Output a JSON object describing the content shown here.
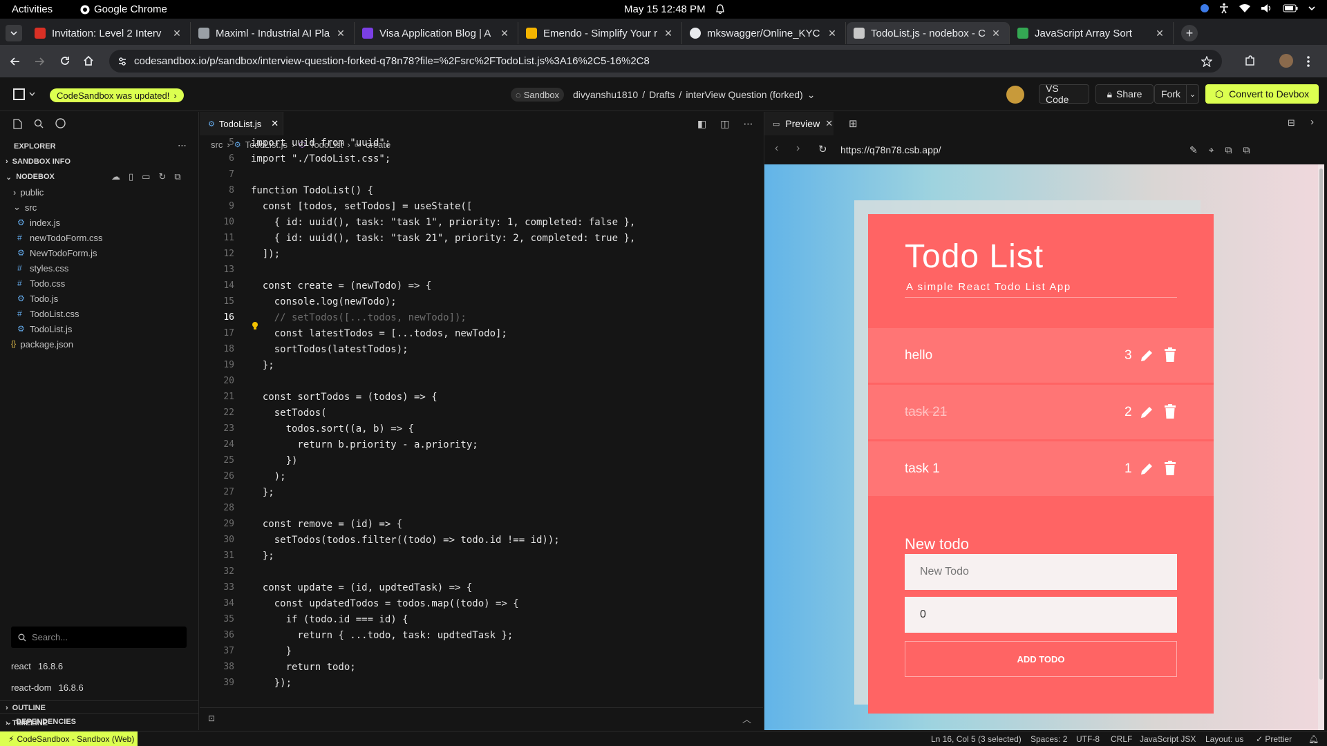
{
  "system": {
    "activities": "Activities",
    "app_name": "Google Chrome",
    "clock": "May 15  12:48 PM"
  },
  "browser": {
    "tabs": [
      {
        "title": "Invitation: Level 2 Interv",
        "color": "#d93025"
      },
      {
        "title": "Maximl - Industrial AI Pla",
        "color": "#9aa0a6"
      },
      {
        "title": "Visa Application Blog | A",
        "color": "#7b3fe4"
      },
      {
        "title": "Emendo - Simplify Your r",
        "color": "#f4b400"
      },
      {
        "title": "mkswagger/Online_KYC",
        "color": "#e8eaed"
      },
      {
        "title": "TodoList.js - nodebox - C",
        "color": "#c8c8c8"
      },
      {
        "title": "JavaScript Array Sort",
        "color": "#34a853"
      }
    ],
    "url": "codesandbox.io/p/sandbox/interview-question-forked-q78n78?file=%2Fsrc%2FTodoList.js%3A16%2C5-16%2C8"
  },
  "header": {
    "updated_pill": "CodeSandbox was updated!",
    "sandbox_badge": "Sandbox",
    "path_user": "divyanshu1810",
    "path_sep1": "/",
    "path_folder": "Drafts",
    "path_sep2": "/",
    "path_name": "interView Question (forked)",
    "vscode": "VS Code",
    "share": "Share",
    "fork": "Fork",
    "convert": "Convert to Devbox"
  },
  "sidebar": {
    "explorer": "EXPLORER",
    "sandbox_info": "SANDBOX INFO",
    "nodebox": "NODEBOX",
    "public": "public",
    "src": "src",
    "files": [
      "index.js",
      "newTodoForm.css",
      "NewTodoForm.js",
      "styles.css",
      "Todo.css",
      "Todo.js",
      "TodoList.css",
      "TodoList.js"
    ],
    "package": "package.json",
    "dependencies": "DEPENDENCIES",
    "search_placeholder": "Search...",
    "deps": [
      {
        "name": "react",
        "version": "16.8.6"
      },
      {
        "name": "react-dom",
        "version": "16.8.6"
      }
    ],
    "outline": "OUTLINE",
    "timeline": "TIMELINE"
  },
  "editor": {
    "tab": "TodoList.js",
    "crumb": [
      "src",
      "TodoList.js",
      "TodoList",
      "create"
    ],
    "lines": [
      {
        "n": "5",
        "t": "import uuid from \"uuid\";"
      },
      {
        "n": "6",
        "t": "import \"./TodoList.css\";"
      },
      {
        "n": "7",
        "t": ""
      },
      {
        "n": "8",
        "t": "function TodoList() {"
      },
      {
        "n": "9",
        "t": "  const [todos, setTodos] = useState(["
      },
      {
        "n": "10",
        "t": "    { id: uuid(), task: \"task 1\", priority: 1, completed: false },"
      },
      {
        "n": "11",
        "t": "    { id: uuid(), task: \"task 21\", priority: 2, completed: true },"
      },
      {
        "n": "12",
        "t": "  ]);"
      },
      {
        "n": "13",
        "t": ""
      },
      {
        "n": "14",
        "t": "  const create = (newTodo) => {"
      },
      {
        "n": "15",
        "t": "    console.log(newTodo);"
      },
      {
        "n": "16",
        "t": "    // setTodos([...todos, newTodo]);"
      },
      {
        "n": "17",
        "t": "    const latestTodos = [...todos, newTodo];"
      },
      {
        "n": "18",
        "t": "    sortTodos(latestTodos);"
      },
      {
        "n": "19",
        "t": "  };"
      },
      {
        "n": "20",
        "t": ""
      },
      {
        "n": "21",
        "t": "  const sortTodos = (todos) => {"
      },
      {
        "n": "22",
        "t": "    setTodos("
      },
      {
        "n": "23",
        "t": "      todos.sort((a, b) => {"
      },
      {
        "n": "24",
        "t": "        return b.priority - a.priority;"
      },
      {
        "n": "25",
        "t": "      })"
      },
      {
        "n": "26",
        "t": "    );"
      },
      {
        "n": "27",
        "t": "  };"
      },
      {
        "n": "28",
        "t": ""
      },
      {
        "n": "29",
        "t": "  const remove = (id) => {"
      },
      {
        "n": "30",
        "t": "    setTodos(todos.filter((todo) => todo.id !== id));"
      },
      {
        "n": "31",
        "t": "  };"
      },
      {
        "n": "32",
        "t": ""
      },
      {
        "n": "33",
        "t": "  const update = (id, updtedTask) => {"
      },
      {
        "n": "34",
        "t": "    const updatedTodos = todos.map((todo) => {"
      },
      {
        "n": "35",
        "t": "      if (todo.id === id) {"
      },
      {
        "n": "36",
        "t": "        return { ...todo, task: updtedTask };"
      },
      {
        "n": "37",
        "t": "      }"
      },
      {
        "n": "38",
        "t": "      return todo;"
      },
      {
        "n": "39",
        "t": "    });"
      }
    ]
  },
  "preview": {
    "tab": "Preview",
    "url": "https://q78n78.csb.app/",
    "app_title": "Todo List",
    "app_subtitle": "A simple React Todo List App",
    "todos": [
      {
        "task": "hello",
        "priority": "3",
        "completed": false
      },
      {
        "task": "task 21",
        "priority": "2",
        "completed": true
      },
      {
        "task": "task 1",
        "priority": "1",
        "completed": false
      }
    ],
    "form_label": "New todo",
    "input_placeholder": "New Todo",
    "priority_value": "0",
    "add_button": "ADD TODO"
  },
  "status": {
    "left": "CodeSandbox - Sandbox (Web)",
    "position": "Ln 16, Col 5 (3 selected)",
    "spaces": "Spaces: 2",
    "encoding": "UTF-8",
    "eol": "CRLF",
    "language": "JavaScript JSX",
    "layout": "Layout: us",
    "prettier": "✓ Prettier"
  },
  "colors": {
    "accent": "#dcff50",
    "card": "#ff6464",
    "todo_row": "#ff7575"
  }
}
